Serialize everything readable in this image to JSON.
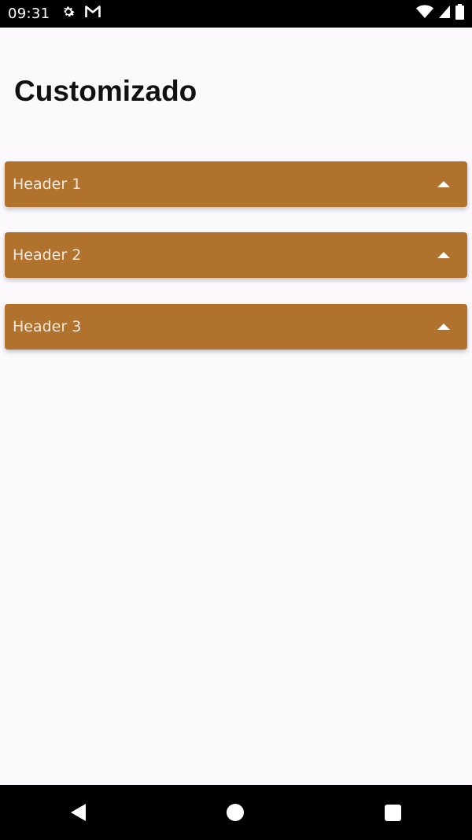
{
  "status_bar": {
    "time": "09:31",
    "icons": [
      "settings-icon",
      "gmail-icon",
      "wifi-icon",
      "signal-icon",
      "battery-icon"
    ]
  },
  "page": {
    "title": "Customizado"
  },
  "accordions": [
    {
      "label": "Header 1",
      "expanded": false
    },
    {
      "label": "Header 2",
      "expanded": false
    },
    {
      "label": "Header 3",
      "expanded": false
    }
  ],
  "colors": {
    "accordion_bg": "#b1722d",
    "background": "#fbf9fc"
  },
  "nav_bar": {
    "icons": [
      "back-icon",
      "home-icon",
      "recents-icon"
    ]
  }
}
